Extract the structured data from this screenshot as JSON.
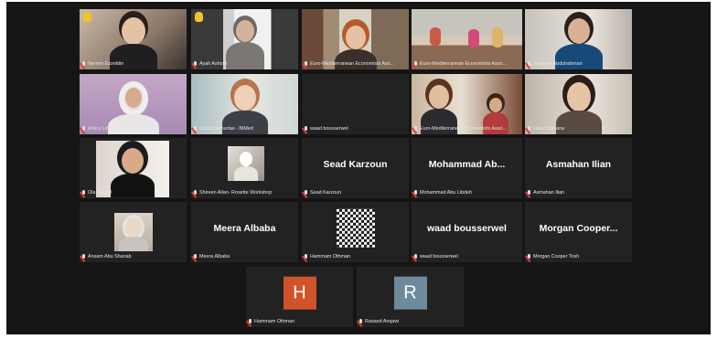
{
  "meeting": {
    "participants": [
      {
        "name": "Nermin Ezzeldin",
        "type": "video",
        "hand_raised": true
      },
      {
        "name": "Ayah Ashour",
        "type": "video",
        "hand_raised": true
      },
      {
        "name": "Euro-Mediterranean Economists Ass...",
        "type": "video"
      },
      {
        "name": "Euro-Mediterranean Economists Asso...",
        "type": "video",
        "active_speaker": true
      },
      {
        "name": "Sabreen Abdulrahman",
        "type": "video"
      },
      {
        "name": "Amira Lin",
        "type": "video"
      },
      {
        "name": "Giulia Demurtas - BiMed",
        "type": "video"
      },
      {
        "name": "waad bousserwel",
        "type": "blank"
      },
      {
        "name": "Euro-Mediterranean Economists Asso...",
        "type": "video"
      },
      {
        "name": "Hala Shabana",
        "type": "video"
      },
      {
        "name": "Ola Gamal",
        "type": "video"
      },
      {
        "name": "Shireen Allan- Rosette Workshop",
        "type": "thumbnail"
      },
      {
        "name": "Sead Karzoun",
        "display": "Sead Karzoun",
        "type": "name"
      },
      {
        "name": "Mohammad Abu Libdeh",
        "display": "Mohammad Ab...",
        "type": "name"
      },
      {
        "name": "Asmahan Ilian",
        "display": "Asmahan Ilian",
        "type": "name"
      },
      {
        "name": "Ansam Abu Shanab",
        "type": "thumbnail"
      },
      {
        "name": "Meera Albaba",
        "display": "Meera Albaba",
        "type": "name"
      },
      {
        "name": "Hammam Othman",
        "type": "pattern"
      },
      {
        "name": "waad bousserwel",
        "display": "waad bousserwel",
        "type": "name"
      },
      {
        "name": "Morgan Cooper Tosh",
        "display": "Morgan Cooper...",
        "type": "name"
      },
      {
        "name": "Hammam Othman",
        "type": "initial",
        "initial": "H",
        "color": "#d0532a"
      },
      {
        "name": "Rasaed Anqawi",
        "type": "initial",
        "initial": "R",
        "color": "#6e8a9c"
      }
    ]
  },
  "colors": {
    "stage_bg": "#151515",
    "tile_bg": "#222222",
    "active_outline": "#d9d36a",
    "muted_mic": "#e23b3b",
    "raised_hand": "#f3c12b"
  },
  "icons": [
    "microphone-muted-icon",
    "raised-hand-icon"
  ]
}
